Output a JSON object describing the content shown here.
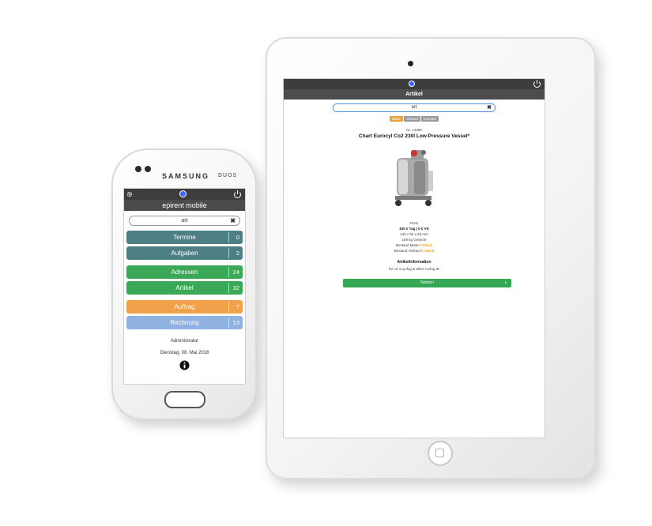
{
  "phone": {
    "brand": "SAMSUNG",
    "model": "DUOS",
    "header_title": "epirent mobile",
    "search_value": "art",
    "menu": [
      {
        "label": "Termine",
        "count": "0",
        "color": "#4e7f85"
      },
      {
        "label": "Aufgaben",
        "count": "2",
        "color": "#4e7f85"
      },
      {
        "label": "Adressen",
        "count": "24",
        "color": "#3aa856"
      },
      {
        "label": "Artikel",
        "count": "32",
        "color": "#3aa856"
      },
      {
        "label": "Auftrag",
        "count": "7",
        "color": "#f2a14b"
      },
      {
        "label": "Rechnung",
        "count": "13",
        "color": "#8fb2e3"
      }
    ],
    "user": "Administrator",
    "date": "Dienstag, 08. Mai 2018"
  },
  "tablet": {
    "header_title": "Artikel",
    "search_value": "art",
    "tabs": [
      "Miete",
      "Verkauf",
      "Inventar"
    ],
    "active_tab": "Miete",
    "article_number": "Nr. 14388",
    "article_title": "Chart Eurocyl Co2 230l Low Pressure Vessel*",
    "price_label": "Preis",
    "price": "100 € Tag | 0 € VK",
    "dimensions": "140 x 66 x 66 mm",
    "weight": "189 kg Gewicht",
    "stock_rent_label": "Bestand Miete",
    "stock_rent_value": "0 Stück",
    "stock_sale_label": "Bestand Verkauf",
    "stock_sale_value": "0 Stück",
    "info_title": "Artikelinformation",
    "info_text": "für LK Cryofog & MDG Icefog ID",
    "notes_button": "Notizen"
  },
  "colors": {
    "accent_orange": "#f39c12",
    "notes_green": "#34a853",
    "header_dark": "#3d3d3d"
  }
}
